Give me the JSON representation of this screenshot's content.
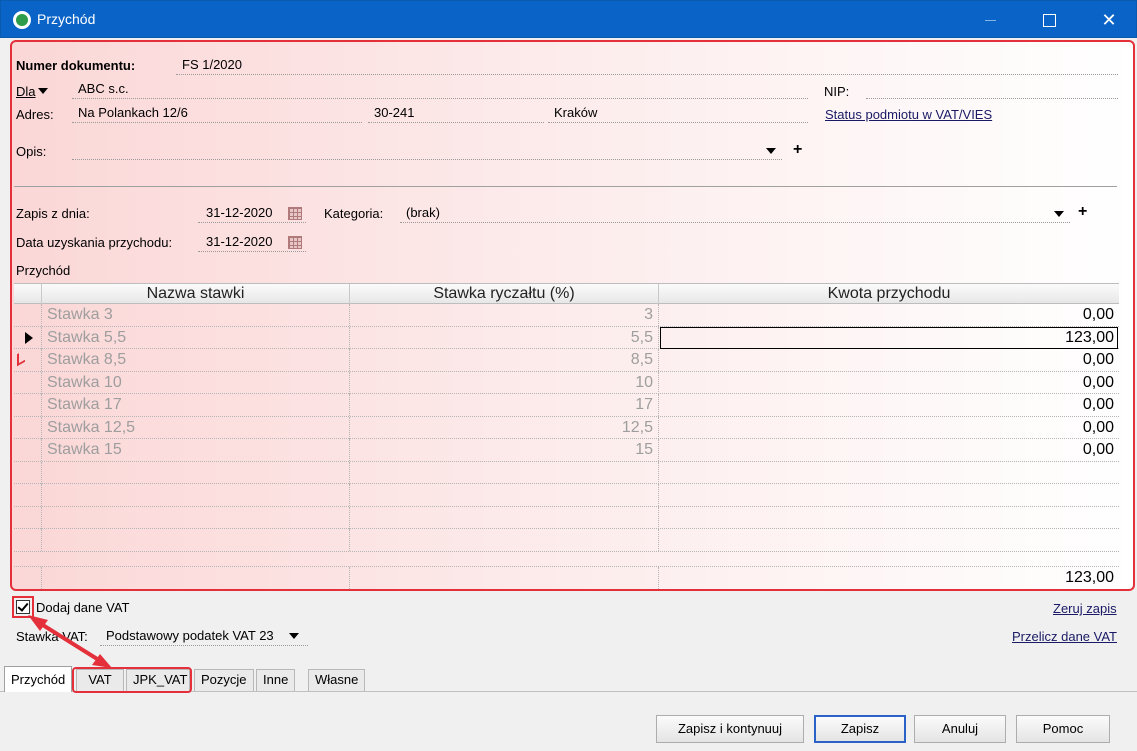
{
  "window": {
    "title": "Przychód"
  },
  "document": {
    "number_label": "Numer dokumentu:",
    "number_value": "FS 1/2020",
    "dla_label": "Dla",
    "dla_value": "ABC s.c.",
    "nip_label": "NIP:",
    "nip_value": "",
    "address_label": "Adres:",
    "street": "Na Polankach 12/6",
    "postal_code": "30-241",
    "city": "Kraków",
    "vat_status_link": "Status podmiotu w VAT/VIES",
    "opis_label": "Opis:",
    "opis_value": "",
    "zapis_label": "Zapis z dnia:",
    "zapis_date": "31-12-2020",
    "kategoria_label": "Kategoria:",
    "kategoria_value": "(brak)",
    "data_uzysk_label": "Data uzyskania przychodu:",
    "data_uzysk_date": "31-12-2020",
    "przychod_label": "Przychód"
  },
  "table": {
    "headers": [
      "Nazwa stawki",
      "Stawka ryczałtu (%)",
      "Kwota przychodu"
    ],
    "rows": [
      {
        "name": "Stawka 3",
        "rate": "3",
        "amount": "0,00"
      },
      {
        "name": "Stawka 5,5",
        "rate": "5,5",
        "amount": "123,00"
      },
      {
        "name": "Stawka 8,5",
        "rate": "8,5",
        "amount": "0,00"
      },
      {
        "name": "Stawka 10",
        "rate": "10",
        "amount": "0,00"
      },
      {
        "name": "Stawka 17",
        "rate": "17",
        "amount": "0,00"
      },
      {
        "name": "Stawka 12,5",
        "rate": "12,5",
        "amount": "0,00"
      },
      {
        "name": "Stawka 15",
        "rate": "15",
        "amount": "0,00"
      }
    ],
    "selected_row": 1,
    "total": "123,00"
  },
  "vat": {
    "add_label": "Dodaj dane VAT",
    "add_checked": true,
    "zeruj_link": "Zeruj zapis",
    "stawka_label": "Stawka VAT:",
    "stawka_value": "Podstawowy podatek VAT 23",
    "przelicz_link": "Przelicz dane VAT"
  },
  "tabs": [
    "Przychód",
    "VAT",
    "JPK_VAT",
    "Pozycje",
    "Inne",
    "Własne"
  ],
  "buttons": {
    "save_continue": "Zapisz i kontynuuj",
    "save": "Zapisz",
    "cancel": "Anuluj",
    "help": "Pomoc"
  },
  "colors": {
    "titlebar": "#0a64c8",
    "highlight": "#e4303a"
  }
}
